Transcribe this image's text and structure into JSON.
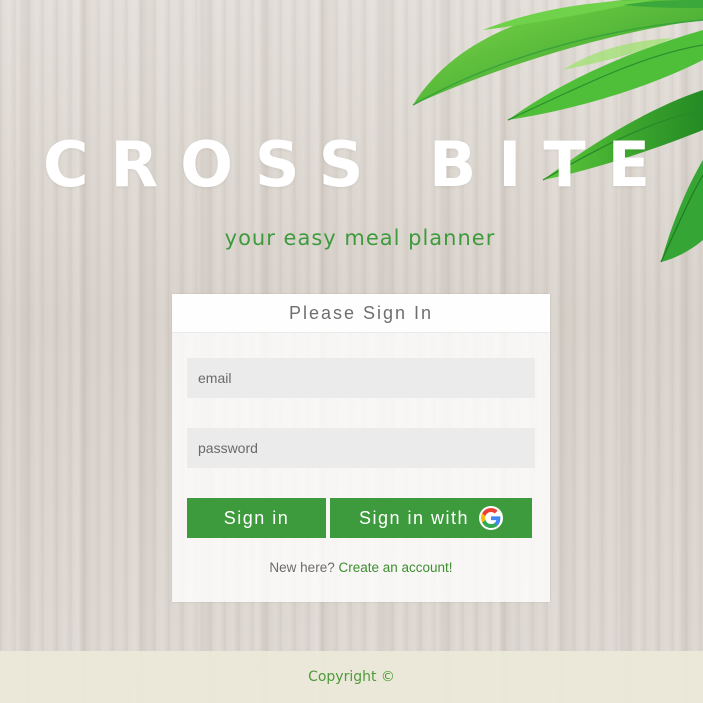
{
  "brand": {
    "title": "CROSS BITE",
    "tagline": "your easy meal planner"
  },
  "signin": {
    "header": "Please Sign In",
    "email_placeholder": "email",
    "password_placeholder": "password",
    "signin_label": "Sign in",
    "google_label": "Sign in with",
    "new_here_text": "New here?",
    "create_account_link": "Create an account!"
  },
  "footer": {
    "copyright": "Copyright ©"
  },
  "colors": {
    "accent_green": "#3d9b3d",
    "link_green": "#3d8f2f",
    "footer_bg": "#ece9d9"
  },
  "icons": {
    "google": "google-g-icon",
    "decoration": "leaves-decoration"
  }
}
